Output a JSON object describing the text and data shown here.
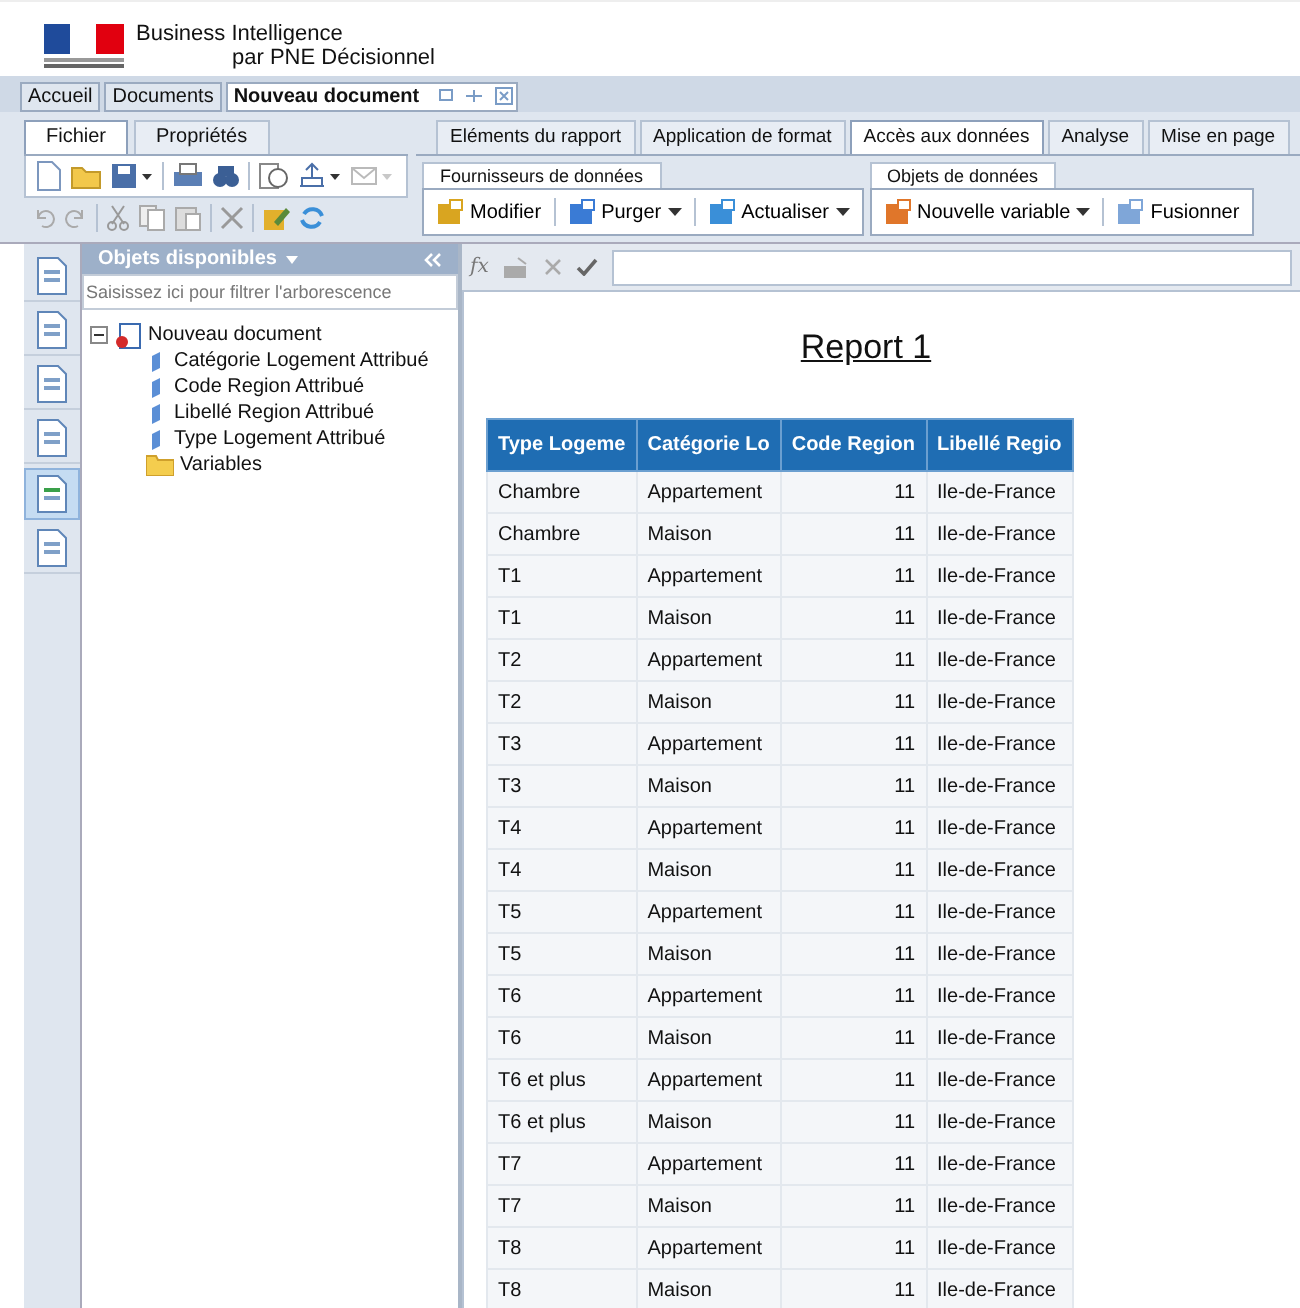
{
  "header": {
    "title": "Business Intelligence",
    "subtitle": "par PNE Décisionnel"
  },
  "doc_tabs": [
    {
      "label": "Accueil",
      "selected": false
    },
    {
      "label": "Documents",
      "selected": false
    },
    {
      "label": "Nouveau document",
      "selected": true
    }
  ],
  "left_ribbon": {
    "tabs": [
      {
        "label": "Fichier",
        "selected": true
      },
      {
        "label": "Propriétés",
        "selected": false
      }
    ]
  },
  "right_ribbon": {
    "tabs": [
      {
        "label": "Eléments du rapport",
        "selected": false
      },
      {
        "label": "Application de format",
        "selected": false
      },
      {
        "label": "Accès aux données",
        "selected": true
      },
      {
        "label": "Analyse",
        "selected": false
      },
      {
        "label": "Mise en page",
        "selected": false
      }
    ],
    "groups": [
      {
        "label": "Fournisseurs de données",
        "buttons": [
          {
            "label": "Modifier",
            "dropdown": false
          },
          {
            "label": "Purger",
            "dropdown": true
          },
          {
            "label": "Actualiser",
            "dropdown": true
          }
        ]
      },
      {
        "label": "Objets de données",
        "buttons": [
          {
            "label": "Nouvelle variable",
            "dropdown": true
          },
          {
            "label": "Fusionner",
            "dropdown": false
          }
        ]
      }
    ]
  },
  "formula_bar": {
    "function_button": "fx"
  },
  "side_icons": [
    {
      "selected": false
    },
    {
      "selected": false
    },
    {
      "selected": false
    },
    {
      "selected": false
    },
    {
      "selected": true
    },
    {
      "selected": false
    }
  ],
  "panel": {
    "title": "Objets disponibles",
    "filter_placeholder": "Saisissez ici pour filtrer l'arborescence",
    "tree": [
      {
        "label": "Nouveau document",
        "kind": "document",
        "expanded": true,
        "children": [
          {
            "label": "Catégorie Logement Attribué",
            "kind": "dimension"
          },
          {
            "label": "Code Region Attribué",
            "kind": "dimension"
          },
          {
            "label": "Libellé Region Attribué",
            "kind": "dimension"
          },
          {
            "label": "Type Logement Attribué",
            "kind": "dimension"
          },
          {
            "label": "Variables",
            "kind": "folder"
          }
        ]
      }
    ]
  },
  "report": {
    "title": "Report 1",
    "columns": [
      "Type Logeme",
      "Catégorie Lo",
      "Code Region",
      "Libellé Regio"
    ],
    "rows": [
      [
        "Chambre",
        "Appartement",
        "11",
        "Ile-de-France"
      ],
      [
        "Chambre",
        "Maison",
        "11",
        "Ile-de-France"
      ],
      [
        "T1",
        "Appartement",
        "11",
        "Ile-de-France"
      ],
      [
        "T1",
        "Maison",
        "11",
        "Ile-de-France"
      ],
      [
        "T2",
        "Appartement",
        "11",
        "Ile-de-France"
      ],
      [
        "T2",
        "Maison",
        "11",
        "Ile-de-France"
      ],
      [
        "T3",
        "Appartement",
        "11",
        "Ile-de-France"
      ],
      [
        "T3",
        "Maison",
        "11",
        "Ile-de-France"
      ],
      [
        "T4",
        "Appartement",
        "11",
        "Ile-de-France"
      ],
      [
        "T4",
        "Maison",
        "11",
        "Ile-de-France"
      ],
      [
        "T5",
        "Appartement",
        "11",
        "Ile-de-France"
      ],
      [
        "T5",
        "Maison",
        "11",
        "Ile-de-France"
      ],
      [
        "T6",
        "Appartement",
        "11",
        "Ile-de-France"
      ],
      [
        "T6",
        "Maison",
        "11",
        "Ile-de-France"
      ],
      [
        "T6 et plus",
        "Appartement",
        "11",
        "Ile-de-France"
      ],
      [
        "T6 et plus",
        "Maison",
        "11",
        "Ile-de-France"
      ],
      [
        "T7",
        "Appartement",
        "11",
        "Ile-de-France"
      ],
      [
        "T7",
        "Maison",
        "11",
        "Ile-de-France"
      ],
      [
        "T8",
        "Appartement",
        "11",
        "Ile-de-France"
      ],
      [
        "T8",
        "Maison",
        "11",
        "Ile-de-France"
      ]
    ]
  }
}
